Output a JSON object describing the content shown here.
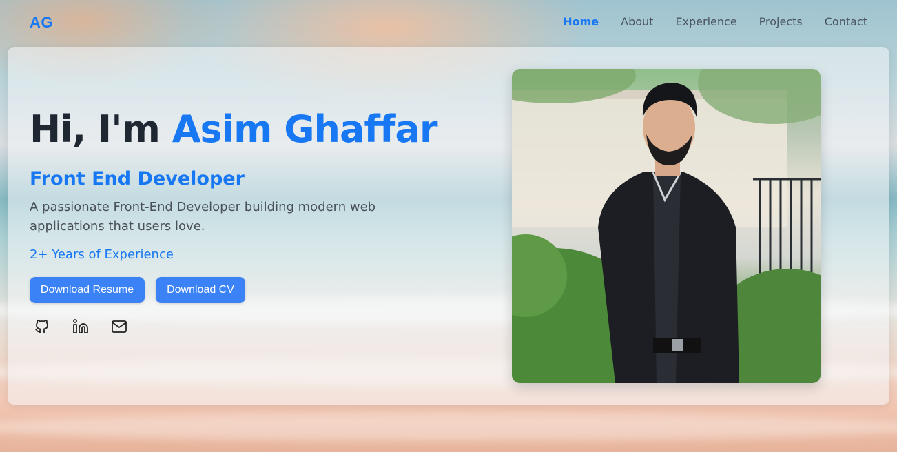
{
  "nav": {
    "logo": "AG",
    "links": [
      "Home",
      "About",
      "Experience",
      "Projects",
      "Contact"
    ],
    "active": "Home"
  },
  "hero": {
    "greeting": "Hi, I'm ",
    "name": "Asim Ghaffar",
    "role": "Front End Developer",
    "description": "A passionate Front-End Developer building modern web applications that users love.",
    "experience": "2+ Years of Experience",
    "buttons": {
      "resume": "Download Resume",
      "cv": "Download CV"
    },
    "socials": [
      "github-icon",
      "linkedin-icon",
      "mail-icon"
    ]
  },
  "colors": {
    "accent": "#1877f2",
    "button": "#3b82f6",
    "heading": "#1f2733",
    "body_text": "#4a5058"
  }
}
